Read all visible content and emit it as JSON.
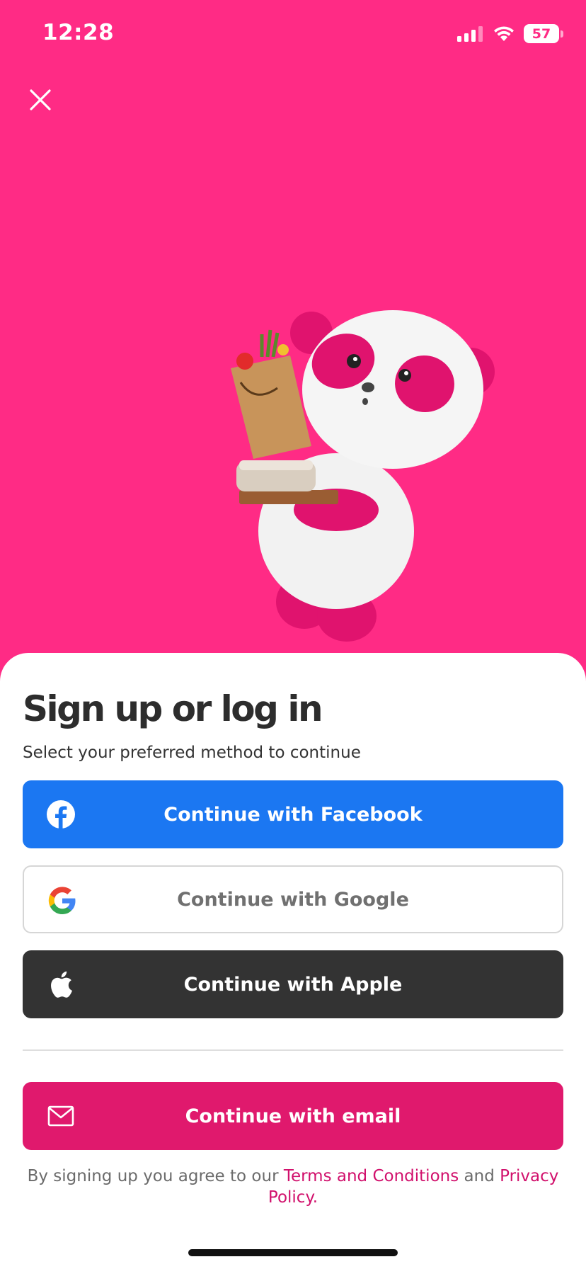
{
  "status_bar": {
    "time": "12:28",
    "battery": "57",
    "icons": [
      "signal-icon",
      "wifi-icon",
      "battery-icon"
    ]
  },
  "header": {
    "close_icon": "close-icon"
  },
  "hero": {
    "illustration": "panda-mascot-with-groceries"
  },
  "sheet": {
    "title": "Sign up or log in",
    "subtitle": "Select your preferred method to continue"
  },
  "buttons": {
    "facebook": {
      "label": "Continue with Facebook",
      "icon": "facebook-icon",
      "color": "#1b77f2"
    },
    "google": {
      "label": "Continue with Google",
      "icon": "google-icon",
      "color": "#ffffff"
    },
    "apple": {
      "label": "Continue with Apple",
      "icon": "apple-icon",
      "color": "#333333"
    },
    "email": {
      "label": "Continue with email",
      "icon": "mail-icon",
      "color": "#e0196d"
    }
  },
  "legal": {
    "prefix": "By signing up you agree to our ",
    "terms": "Terms and Conditions",
    "middle": " and ",
    "privacy": "Privacy Policy",
    "suffix": "."
  },
  "colors": {
    "background": "#ff2b85",
    "accent": "#e0196d",
    "link": "#d1106c"
  }
}
